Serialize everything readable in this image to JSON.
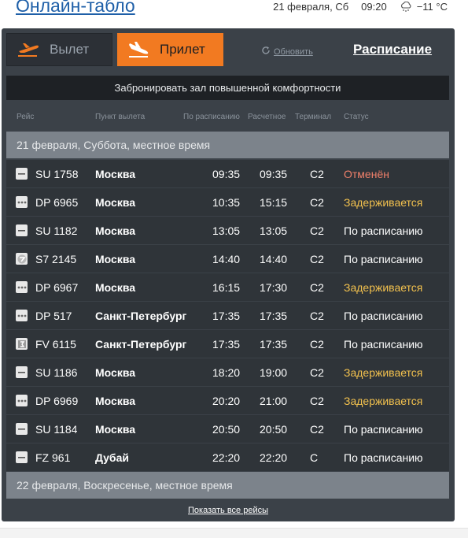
{
  "header": {
    "title": "Онлайн-табло",
    "date": "21 февраля, Сб",
    "time": "09:20",
    "temperature": "−11 °C"
  },
  "tabs": {
    "departure": "Вылет",
    "arrival": "Прилет"
  },
  "refresh_label": "Обновить",
  "schedule_link": "Расписание",
  "promo_text": "Забронировать зал повышенной комфортности",
  "columns": {
    "flight": "Рейс",
    "origin": "Пункт вылета",
    "scheduled": "По расписанию",
    "estimated": "Расчетное",
    "terminal": "Терминал",
    "status": "Статус"
  },
  "day_header_1": "21 февраля, Суббота, местное время",
  "day_header_2": "22 февраля, Воскресенье, местное время",
  "flights": [
    {
      "logo": "su",
      "flight": "SU 1758",
      "city": "Москва",
      "sched": "09:35",
      "est": "09:35",
      "term": "C2",
      "status": "Отменён",
      "status_type": "cancelled"
    },
    {
      "logo": "dp",
      "flight": "DP 6965",
      "city": "Москва",
      "sched": "10:35",
      "est": "15:15",
      "term": "C2",
      "status": "Задерживается",
      "status_type": "delayed"
    },
    {
      "logo": "su",
      "flight": "SU 1182",
      "city": "Москва",
      "sched": "13:05",
      "est": "13:05",
      "term": "C2",
      "status": "По расписанию",
      "status_type": "ok"
    },
    {
      "logo": "s7",
      "flight": "S7 2145",
      "city": "Москва",
      "sched": "14:40",
      "est": "14:40",
      "term": "C2",
      "status": "По расписанию",
      "status_type": "ok"
    },
    {
      "logo": "dp",
      "flight": "DP 6967",
      "city": "Москва",
      "sched": "16:15",
      "est": "17:30",
      "term": "C2",
      "status": "Задерживается",
      "status_type": "delayed"
    },
    {
      "logo": "dp",
      "flight": "DP 517",
      "city": "Санкт-Петербург",
      "sched": "17:35",
      "est": "17:35",
      "term": "C2",
      "status": "По расписанию",
      "status_type": "ok"
    },
    {
      "logo": "fv",
      "flight": "FV 6115",
      "city": "Санкт-Петербург",
      "sched": "17:35",
      "est": "17:35",
      "term": "C2",
      "status": "По расписанию",
      "status_type": "ok"
    },
    {
      "logo": "su",
      "flight": "SU 1186",
      "city": "Москва",
      "sched": "18:20",
      "est": "19:00",
      "term": "C2",
      "status": "Задерживается",
      "status_type": "delayed"
    },
    {
      "logo": "dp",
      "flight": "DP 6969",
      "city": "Москва",
      "sched": "20:20",
      "est": "21:00",
      "term": "C2",
      "status": "Задерживается",
      "status_type": "delayed"
    },
    {
      "logo": "su",
      "flight": "SU 1184",
      "city": "Москва",
      "sched": "20:50",
      "est": "20:50",
      "term": "C2",
      "status": "По расписанию",
      "status_type": "ok"
    },
    {
      "logo": "fz",
      "flight": "FZ 961",
      "city": "Дубай",
      "sched": "22:20",
      "est": "22:20",
      "term": "C",
      "status": "По расписанию",
      "status_type": "ok"
    }
  ],
  "status_colors": {
    "cancelled": "#f0806a",
    "delayed": "#f2c14e",
    "ok": "#ffffff"
  },
  "show_all_link": "Показать все рейсы"
}
